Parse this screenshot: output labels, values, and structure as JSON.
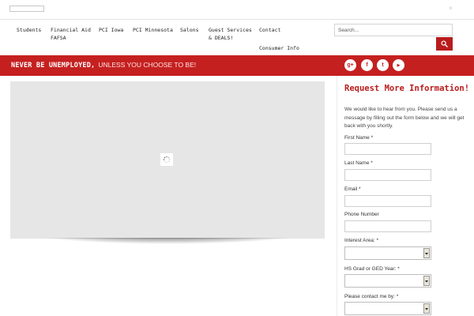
{
  "nav": {
    "items": [
      {
        "label": "Students"
      },
      {
        "label": "Financial Aid\nFAFSA"
      },
      {
        "label": "PCI Iowa"
      },
      {
        "label": "PCI Minnesota"
      },
      {
        "label": "Salons"
      },
      {
        "label": "Guest Services\n& DEALS!"
      },
      {
        "label": "Contact"
      },
      {
        "label": "Consumer Info"
      }
    ],
    "search_placeholder": "Search..."
  },
  "banner": {
    "bold_text": "NEVER BE UNEMPLOYED,",
    "light_text": "UNLESS YOU CHOOSE TO BE!"
  },
  "social": [
    {
      "icon": "google-plus-icon",
      "glyph": "g+"
    },
    {
      "icon": "facebook-icon",
      "glyph": "f"
    },
    {
      "icon": "twitter-icon",
      "glyph": "t"
    },
    {
      "icon": "youtube-icon",
      "glyph": "▶"
    }
  ],
  "sidebar": {
    "title": "Request More Information!",
    "intro": "We would like to hear from you. Please send us a message by filling out the form below and we will get back with you shortly.",
    "fields": [
      {
        "label": "First Name *",
        "type": "text"
      },
      {
        "label": "Last Name *",
        "type": "text"
      },
      {
        "label": "Email *",
        "type": "text"
      },
      {
        "label": "Phone Number",
        "type": "text"
      },
      {
        "label": "Interest Area: *",
        "type": "select"
      },
      {
        "label": "HS Grad or GED Year: *",
        "type": "select"
      },
      {
        "label": "Please contact me by: *",
        "type": "select"
      }
    ]
  },
  "colors": {
    "brand_red": "#c52020",
    "title_red": "#b91c1c",
    "slider_bg": "#e6e6e6"
  }
}
